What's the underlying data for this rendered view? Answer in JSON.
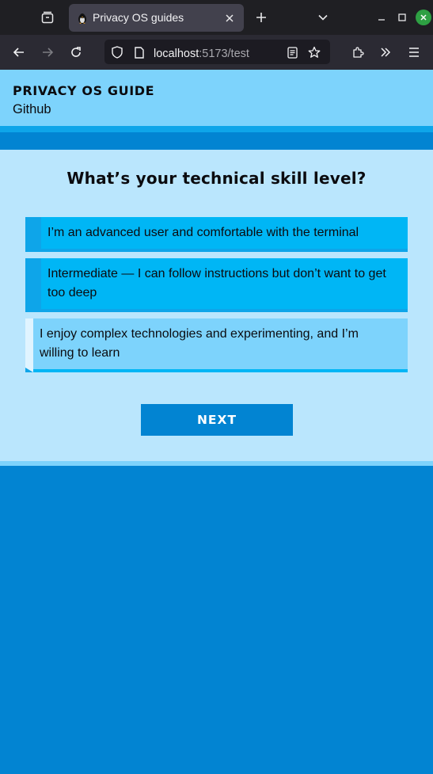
{
  "browser": {
    "tab": {
      "title": "Privacy OS guides",
      "favicon": "penguin-icon"
    },
    "url": {
      "host": "localhost",
      "path": ":5173/test"
    },
    "icons": {
      "list_all_tabs": "tab-overview-icon",
      "new_tab": "plus-icon",
      "tab_list": "chevron-down-icon",
      "minimize": "minimize-icon",
      "maximize": "maximize-icon",
      "close": "close-icon",
      "back": "arrow-left-icon",
      "forward": "arrow-right-icon",
      "reload": "reload-icon",
      "shield": "shield-icon",
      "page": "page-icon",
      "reader": "reader-view-icon",
      "bookmark": "star-icon",
      "extensions": "puzzle-icon",
      "overflow": "chevrons-right-icon",
      "menu": "hamburger-menu-icon"
    },
    "colors": {
      "close_button": "#2ea043"
    }
  },
  "header": {
    "brand": "PRIVACY OS GUIDE",
    "link": "Github"
  },
  "quiz": {
    "question": "What’s your technical skill level?",
    "options": [
      {
        "label": "I’m an advanced user and comfortable with the terminal",
        "selected": false
      },
      {
        "label": "Intermediate — I can follow instructions but don’t want to get too deep",
        "selected": false
      },
      {
        "label": "I enjoy complex technologies and experimenting, and I’m willing to learn",
        "selected": true
      }
    ],
    "next_label": "NEXT"
  },
  "colors": {
    "header_bg": "#7dd3fc",
    "card_bg": "#bae6fd",
    "option_bg": "#00b6f5",
    "option_selected_bg": "#7dd3fc",
    "accent": "#0ea5e9",
    "primary": "#0284d2"
  }
}
